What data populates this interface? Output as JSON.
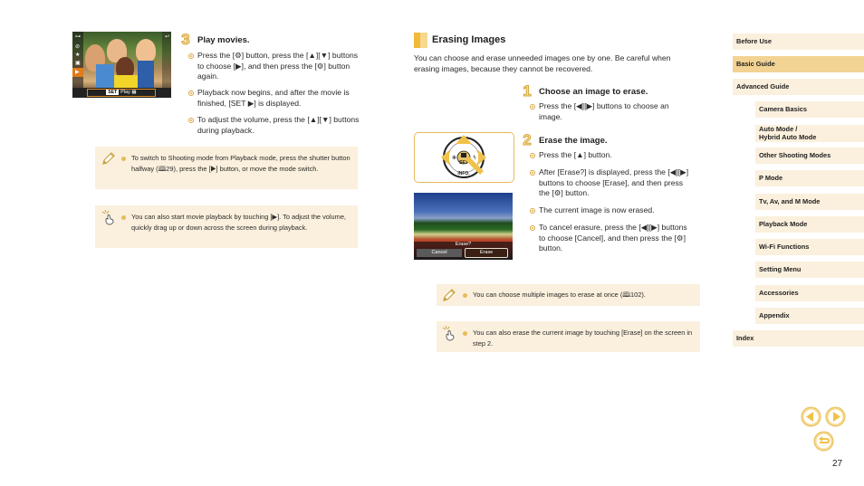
{
  "left": {
    "screen1": {
      "bar_set": "SET",
      "bar_label": "Play",
      "bar_icon": "movie-icon"
    },
    "step3": {
      "number": "3",
      "title": "Play movies.",
      "bullets": [
        "Press the [⚙] button, press the [▲][▼] buttons to choose [▶], and then press the [⚙] button again.",
        "Playback now begins, and after the movie is finished, [SET ▶] is displayed.",
        "To adjust the volume, press the [▲][▼] buttons during playback."
      ]
    },
    "note_pencil": "To switch to Shooting mode from Playback mode, press the shutter button halfway (🕮29), press the [▶] button, or move the mode switch.",
    "note_touch": "You can also start movie playback by touching [▶]. To adjust the volume, quickly drag up or down across the screen during playback."
  },
  "middle": {
    "section_title": "Erasing Images",
    "intro": "You can choose and erase unneeded images one by one. Be careful when erasing images, because they cannot be recovered.",
    "pad_labels": {
      "center": "SET",
      "bottom": "INFO."
    },
    "step1": {
      "number": "1",
      "title": "Choose an image to erase.",
      "bullets": [
        "Press the [◀][▶] buttons to choose an image."
      ]
    },
    "step2": {
      "number": "2",
      "title": "Erase the image.",
      "bullets": [
        "Press the [▲] button.",
        "After [Erase?] is displayed, press the [◀][▶] buttons to choose [Erase], and then press the [⚙] button.",
        "The current image is now erased.",
        "To cancel erasure, press the [◀][▶] buttons to choose [Cancel], and then press the [⚙] button."
      ]
    },
    "screen2": {
      "question": "Erase?",
      "cancel": "Cancel",
      "erase": "Erase"
    },
    "note_pencil": "You can choose multiple images to erase at once (🕮102).",
    "note_touch": "You can also erase the current image by touching [Erase] on the screen in step 2."
  },
  "nav": {
    "items": [
      {
        "label": "Before Use",
        "level": "top",
        "active": false
      },
      {
        "label": "Basic Guide",
        "level": "top",
        "active": true
      },
      {
        "label": "Advanced Guide",
        "level": "top",
        "active": false
      },
      {
        "label": "Camera Basics",
        "level": "sub",
        "active": false
      },
      {
        "label": "Auto Mode /\nHybrid Auto Mode",
        "level": "sub",
        "active": false
      },
      {
        "label": "Other Shooting Modes",
        "level": "sub",
        "active": false
      },
      {
        "label": "P Mode",
        "level": "sub",
        "active": false
      },
      {
        "label": "Tv, Av, and M Mode",
        "level": "sub",
        "active": false
      },
      {
        "label": "Playback Mode",
        "level": "sub",
        "active": false
      },
      {
        "label": "Wi-Fi Functions",
        "level": "sub",
        "active": false
      },
      {
        "label": "Setting Menu",
        "level": "sub",
        "active": false
      },
      {
        "label": "Accessories",
        "level": "sub",
        "active": false
      },
      {
        "label": "Appendix",
        "level": "sub",
        "active": false
      },
      {
        "label": "Index",
        "level": "top",
        "active": false
      }
    ],
    "prev_icon": "prev-page-icon",
    "next_icon": "next-page-icon",
    "back_icon": "return-icon"
  },
  "colors": {
    "accent": "#e6bb5a",
    "note_bg": "#fbf0dd",
    "nav_active": "#f2d393"
  },
  "page_number": "27"
}
